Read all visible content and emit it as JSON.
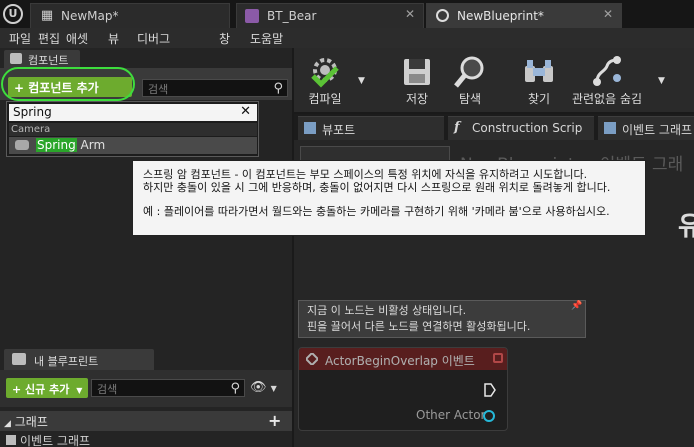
{
  "tabs": [
    {
      "label": "NewMap*",
      "icon": "level-icon"
    },
    {
      "label": "BT_Bear",
      "icon": "behavior-tree-icon"
    },
    {
      "label": "NewBlueprint*",
      "icon": "blueprint-icon"
    }
  ],
  "menu": [
    "파일",
    "편집",
    "애셋",
    "뷰",
    "디버그",
    "창",
    "도움말"
  ],
  "components_panel": {
    "tab_label": "컴포넌트",
    "add_button": "+ 컴포넌트 추가",
    "search_placeholder": "검색"
  },
  "component_dropdown": {
    "search_value": "Spring",
    "category": "Camera",
    "item_match": "Spring",
    "item_rest": " Arm"
  },
  "tooltip": {
    "line1": "스프링 암 컴포넌트 - 이 컴포넌트는 부모 스페이스의 특정 위치에 자식을 유지하려고 시도합니다.",
    "line2": "하지만 충돌이 있을 시 그에 반응하며, 충돌이 없어지면 다시 스프링으로 원래 위치로 돌려놓게 합니다.",
    "line3": "예 : 플레이어를 따라가면서 월드와는 충돌하는 카메라를 구현하기 위해 '카메라 붐'으로 사용하십시오."
  },
  "toolbar": [
    {
      "label": "컴파일",
      "icon": "compile-icon"
    },
    {
      "label": "저장",
      "icon": "save-icon"
    },
    {
      "label": "탐색",
      "icon": "browse-icon"
    },
    {
      "label": "찾기",
      "icon": "find-icon"
    },
    {
      "label": "관련없음 숨김",
      "icon": "hide-unrelated-icon"
    }
  ],
  "editor_tabs": [
    {
      "label": "뷰포트",
      "icon": "viewport-icon"
    },
    {
      "label": "Construction Scrip",
      "icon": "function-icon"
    },
    {
      "label": "이벤트 그래프",
      "icon": "graph-icon"
    }
  ],
  "graph": {
    "breadcrumb": "NewBlueprint > 이벤트 그래",
    "big_char": "유",
    "comment_line1": "지금 이 노드는 비활성 상태입니다.",
    "comment_line2": "핀을 끌어서 다른 노드를 연결하면 활성화됩니다.",
    "event_title": "ActorBeginOverlap 이벤트",
    "pin_label": "Other Actor"
  },
  "my_blueprint": {
    "tab_label": "내 블루프린트",
    "add_button": "+ 신규 추가",
    "search_placeholder": "검색",
    "graph_section": "그래프",
    "graph_item": "이벤트 그래프"
  },
  "colors": {
    "accent_green": "#6dab2e",
    "highlight_ring": "#3ddd3d",
    "event_red": "#6b1e1e",
    "pin_cyan": "#26b8d8"
  }
}
